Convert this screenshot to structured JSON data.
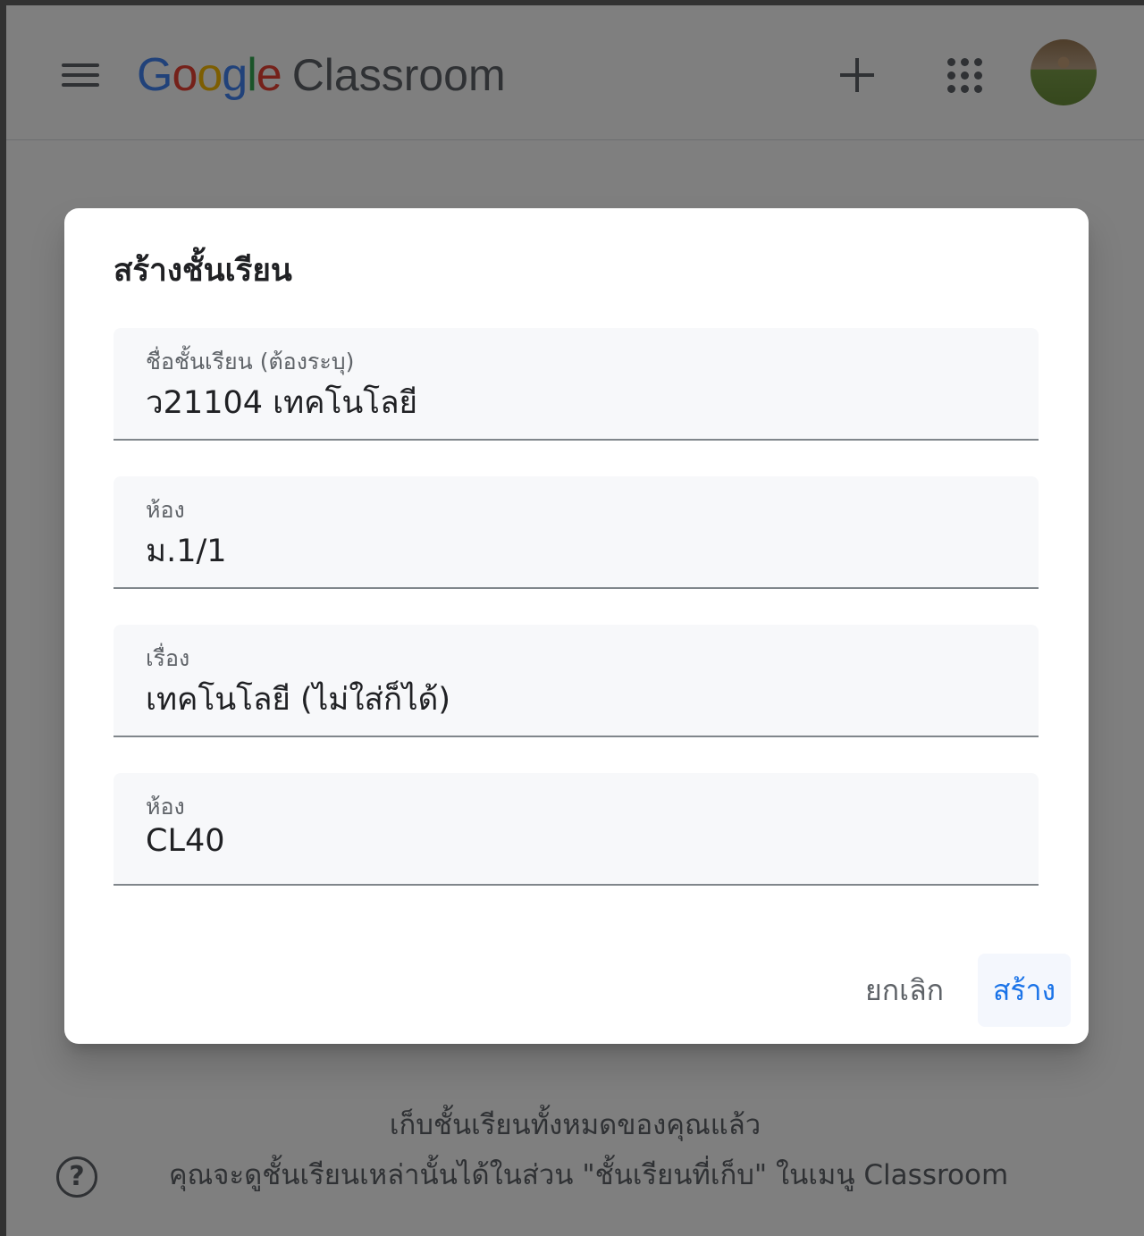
{
  "app": {
    "logo_google": [
      "G",
      "o",
      "o",
      "g",
      "l",
      "e"
    ],
    "logo_product": "Classroom"
  },
  "header": {
    "icons": [
      "menu-icon",
      "plus-icon",
      "apps-grid-icon",
      "avatar"
    ]
  },
  "background": {
    "archived_line1": "เก็บชั้นเรียนทั้งหมดของคุณแล้ว",
    "archived_line2": "คุณจะดูชั้นเรียนเหล่านั้นได้ในส่วน \"ชั้นเรียนที่เก็บ\" ในเมนู Classroom",
    "help_symbol": "?"
  },
  "dialog": {
    "title": "สร้างชั้นเรียน",
    "fields": [
      {
        "label": "ชื่อชั้นเรียน (ต้องระบุ)",
        "value": "ว21104 เทคโนโลยี"
      },
      {
        "label": "ห้อง",
        "value": "ม.1/1"
      },
      {
        "label": "เรื่อง",
        "value": "เทคโนโลยี (ไม่ใส่ก็ได้)"
      },
      {
        "label": "ห้อง",
        "value": "CL40"
      }
    ],
    "cancel_label": "ยกเลิก",
    "create_label": "สร้าง"
  },
  "colors": {
    "google_blue": "#4285f4",
    "google_red": "#ea4335",
    "google_yellow": "#fbbc04",
    "google_green": "#34a853",
    "accent": "#1a73e8"
  }
}
